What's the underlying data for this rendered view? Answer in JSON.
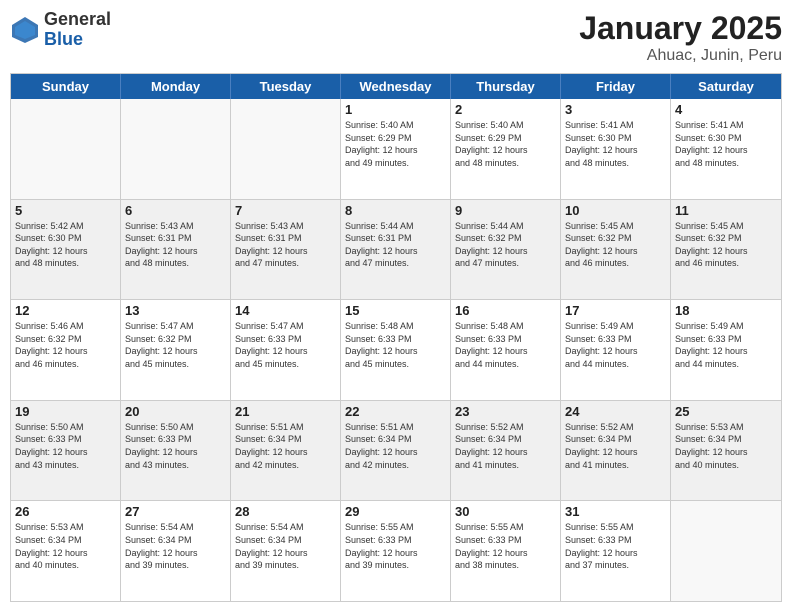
{
  "header": {
    "logo_general": "General",
    "logo_blue": "Blue",
    "title": "January 2025",
    "subtitle": "Ahuac, Junin, Peru"
  },
  "days": [
    "Sunday",
    "Monday",
    "Tuesday",
    "Wednesday",
    "Thursday",
    "Friday",
    "Saturday"
  ],
  "weeks": [
    [
      {
        "date": "",
        "info": ""
      },
      {
        "date": "",
        "info": ""
      },
      {
        "date": "",
        "info": ""
      },
      {
        "date": "1",
        "info": "Sunrise: 5:40 AM\nSunset: 6:29 PM\nDaylight: 12 hours\nand 49 minutes."
      },
      {
        "date": "2",
        "info": "Sunrise: 5:40 AM\nSunset: 6:29 PM\nDaylight: 12 hours\nand 48 minutes."
      },
      {
        "date": "3",
        "info": "Sunrise: 5:41 AM\nSunset: 6:30 PM\nDaylight: 12 hours\nand 48 minutes."
      },
      {
        "date": "4",
        "info": "Sunrise: 5:41 AM\nSunset: 6:30 PM\nDaylight: 12 hours\nand 48 minutes."
      }
    ],
    [
      {
        "date": "5",
        "info": "Sunrise: 5:42 AM\nSunset: 6:30 PM\nDaylight: 12 hours\nand 48 minutes."
      },
      {
        "date": "6",
        "info": "Sunrise: 5:43 AM\nSunset: 6:31 PM\nDaylight: 12 hours\nand 48 minutes."
      },
      {
        "date": "7",
        "info": "Sunrise: 5:43 AM\nSunset: 6:31 PM\nDaylight: 12 hours\nand 47 minutes."
      },
      {
        "date": "8",
        "info": "Sunrise: 5:44 AM\nSunset: 6:31 PM\nDaylight: 12 hours\nand 47 minutes."
      },
      {
        "date": "9",
        "info": "Sunrise: 5:44 AM\nSunset: 6:32 PM\nDaylight: 12 hours\nand 47 minutes."
      },
      {
        "date": "10",
        "info": "Sunrise: 5:45 AM\nSunset: 6:32 PM\nDaylight: 12 hours\nand 46 minutes."
      },
      {
        "date": "11",
        "info": "Sunrise: 5:45 AM\nSunset: 6:32 PM\nDaylight: 12 hours\nand 46 minutes."
      }
    ],
    [
      {
        "date": "12",
        "info": "Sunrise: 5:46 AM\nSunset: 6:32 PM\nDaylight: 12 hours\nand 46 minutes."
      },
      {
        "date": "13",
        "info": "Sunrise: 5:47 AM\nSunset: 6:32 PM\nDaylight: 12 hours\nand 45 minutes."
      },
      {
        "date": "14",
        "info": "Sunrise: 5:47 AM\nSunset: 6:33 PM\nDaylight: 12 hours\nand 45 minutes."
      },
      {
        "date": "15",
        "info": "Sunrise: 5:48 AM\nSunset: 6:33 PM\nDaylight: 12 hours\nand 45 minutes."
      },
      {
        "date": "16",
        "info": "Sunrise: 5:48 AM\nSunset: 6:33 PM\nDaylight: 12 hours\nand 44 minutes."
      },
      {
        "date": "17",
        "info": "Sunrise: 5:49 AM\nSunset: 6:33 PM\nDaylight: 12 hours\nand 44 minutes."
      },
      {
        "date": "18",
        "info": "Sunrise: 5:49 AM\nSunset: 6:33 PM\nDaylight: 12 hours\nand 44 minutes."
      }
    ],
    [
      {
        "date": "19",
        "info": "Sunrise: 5:50 AM\nSunset: 6:33 PM\nDaylight: 12 hours\nand 43 minutes."
      },
      {
        "date": "20",
        "info": "Sunrise: 5:50 AM\nSunset: 6:33 PM\nDaylight: 12 hours\nand 43 minutes."
      },
      {
        "date": "21",
        "info": "Sunrise: 5:51 AM\nSunset: 6:34 PM\nDaylight: 12 hours\nand 42 minutes."
      },
      {
        "date": "22",
        "info": "Sunrise: 5:51 AM\nSunset: 6:34 PM\nDaylight: 12 hours\nand 42 minutes."
      },
      {
        "date": "23",
        "info": "Sunrise: 5:52 AM\nSunset: 6:34 PM\nDaylight: 12 hours\nand 41 minutes."
      },
      {
        "date": "24",
        "info": "Sunrise: 5:52 AM\nSunset: 6:34 PM\nDaylight: 12 hours\nand 41 minutes."
      },
      {
        "date": "25",
        "info": "Sunrise: 5:53 AM\nSunset: 6:34 PM\nDaylight: 12 hours\nand 40 minutes."
      }
    ],
    [
      {
        "date": "26",
        "info": "Sunrise: 5:53 AM\nSunset: 6:34 PM\nDaylight: 12 hours\nand 40 minutes."
      },
      {
        "date": "27",
        "info": "Sunrise: 5:54 AM\nSunset: 6:34 PM\nDaylight: 12 hours\nand 39 minutes."
      },
      {
        "date": "28",
        "info": "Sunrise: 5:54 AM\nSunset: 6:34 PM\nDaylight: 12 hours\nand 39 minutes."
      },
      {
        "date": "29",
        "info": "Sunrise: 5:55 AM\nSunset: 6:33 PM\nDaylight: 12 hours\nand 39 minutes."
      },
      {
        "date": "30",
        "info": "Sunrise: 5:55 AM\nSunset: 6:33 PM\nDaylight: 12 hours\nand 38 minutes."
      },
      {
        "date": "31",
        "info": "Sunrise: 5:55 AM\nSunset: 6:33 PM\nDaylight: 12 hours\nand 37 minutes."
      },
      {
        "date": "",
        "info": ""
      }
    ]
  ]
}
